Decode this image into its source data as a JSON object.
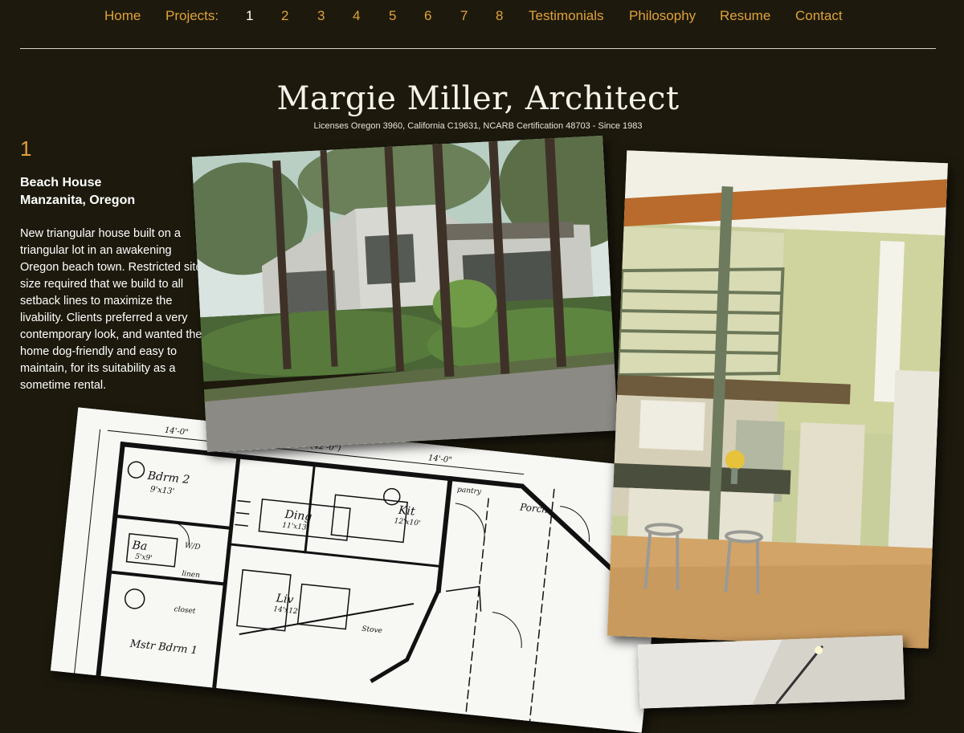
{
  "nav": {
    "home": "Home",
    "projects_label": "Projects:",
    "projects": [
      "1",
      "2",
      "3",
      "4",
      "5",
      "6",
      "7",
      "8"
    ],
    "testimonials": "Testimonials",
    "philosophy": "Philosophy",
    "resume": "Resume",
    "contact": "Contact",
    "active_project": "1"
  },
  "header": {
    "title": "Margie Miller, Architect",
    "subtitle": "Licenses Oregon 3960, California C19631, NCARB Certification 48703 - Since 1983"
  },
  "project": {
    "number": "1",
    "name_line1": "Beach House",
    "name_line2": "Manzanita, Oregon",
    "description": "New triangular house built on a triangular lot in an awakening Oregon beach town. Restricted site size required that we build to all setback lines to maximize the livability. Clients preferred a very contemporary look, and wanted the home dog-friendly and easy to maintain, for its suitability as a sometime rental."
  },
  "plan_labels": {
    "bdrm2": "Bdrm 2",
    "bdrm2_size": "9'x13'",
    "ba": "Ba",
    "ba_size": "5'x9'",
    "ding": "Ding",
    "ding_size": "11'x13'",
    "kit": "Kit",
    "kit_size": "12'x10'",
    "liv": "Liv",
    "liv_size": "14'x12'",
    "mstr": "Mstr Bdrm 1",
    "porch": "Porch",
    "pantry": "pantry",
    "closet": "closet",
    "wd": "W/D",
    "linen": "linen",
    "stove": "Stove",
    "dim_top": "14'-0\"",
    "dim_mid": "19'-0\" (42'-0\")",
    "dim_right": "14'-0\""
  },
  "colors": {
    "background": "#1d1a0d",
    "accent": "#e0a13a",
    "text": "#ffffff"
  }
}
